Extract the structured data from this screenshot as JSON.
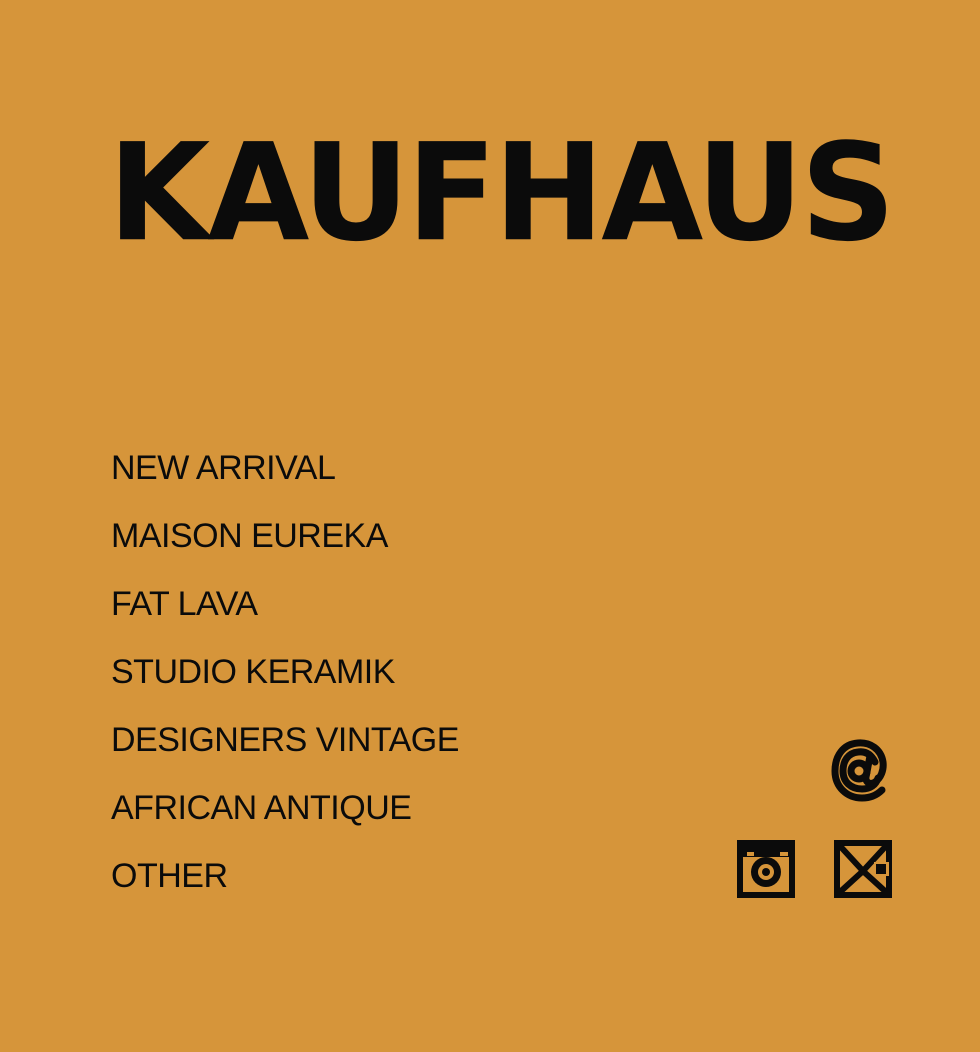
{
  "header": {
    "brand": "KAUFHAUS"
  },
  "nav": {
    "items": [
      {
        "label": "NEW ARRIVAL"
      },
      {
        "label": "MAISON EUREKA"
      },
      {
        "label": "FAT LAVA"
      },
      {
        "label": "STUDIO KERAMIK"
      },
      {
        "label": "DESIGNERS VINTAGE"
      },
      {
        "label": "AFRICAN ANTIQUE"
      },
      {
        "label": "OTHER"
      }
    ]
  },
  "icons": {
    "at": "at-icon",
    "instagram": "instagram-icon",
    "mail": "mail-icon"
  },
  "colors": {
    "background": "#d6953a",
    "text": "#0b0b0b"
  }
}
